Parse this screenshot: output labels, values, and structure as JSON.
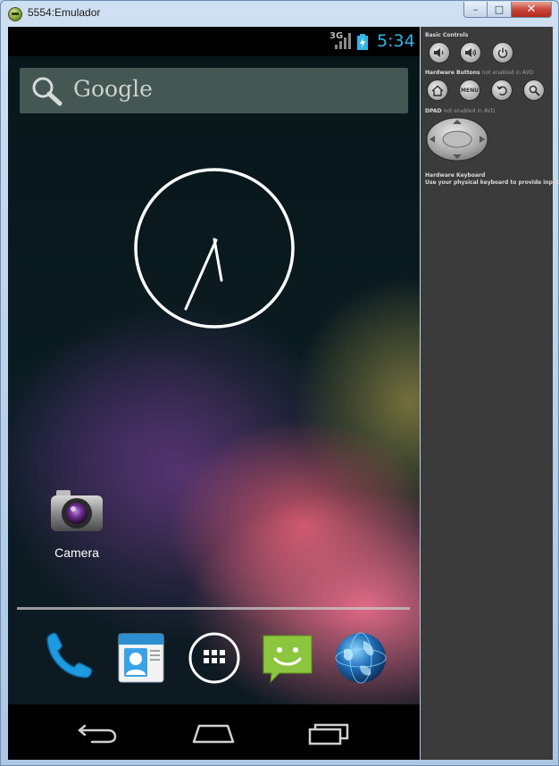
{
  "window": {
    "title": "5554:Emulador",
    "minimize_label": "–",
    "maximize_label": "□",
    "close_label": "✕"
  },
  "status_bar": {
    "network": "3G",
    "time": "5:34",
    "time_color": "#33b5e5"
  },
  "search": {
    "label": "Google"
  },
  "clock_widget": {
    "hour_hand_time": "5:34"
  },
  "desktop": {
    "apps": [
      {
        "label": "Camera",
        "icon": "camera-icon"
      }
    ]
  },
  "dock": {
    "items": [
      {
        "name": "phone",
        "icon": "phone-icon"
      },
      {
        "name": "contacts",
        "icon": "contacts-icon"
      },
      {
        "name": "app-drawer",
        "icon": "app-drawer-icon"
      },
      {
        "name": "messaging",
        "icon": "messaging-icon"
      },
      {
        "name": "browser",
        "icon": "globe-icon"
      }
    ]
  },
  "nav_bar": {
    "buttons": [
      {
        "name": "back",
        "icon": "back-icon"
      },
      {
        "name": "home",
        "icon": "home-icon"
      },
      {
        "name": "recent",
        "icon": "recent-apps-icon"
      }
    ]
  },
  "controls": {
    "basic_title": "Basic Controls",
    "hardware_title": "Hardware Buttons",
    "hardware_note": "not enabled in AVD",
    "dpad_title": "DPAD",
    "dpad_note": "not enabled in AVD",
    "keyboard_title": "Hardware Keyboard",
    "keyboard_note": "Use your physical keyboard to provide input",
    "menu_label": "MENU"
  }
}
